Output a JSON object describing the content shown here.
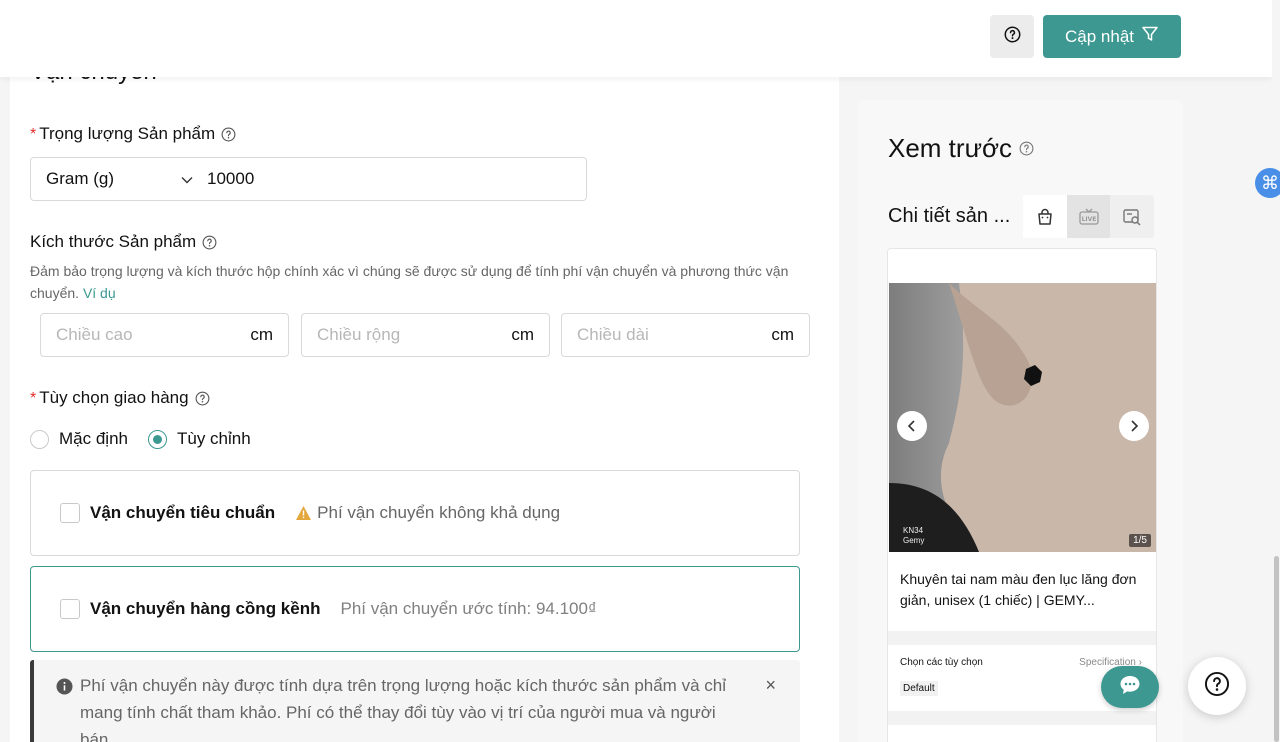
{
  "header": {
    "update_label": "Cập nhật",
    "help_icon": "question-circle-icon",
    "update_icon": "filter-funnel-icon"
  },
  "shipping": {
    "section_title": "Vận chuyển",
    "weight": {
      "label": "Trọng lượng Sản phẩm",
      "unit_selected": "Gram (g)",
      "value": "10000"
    },
    "dimensions": {
      "label": "Kích thước Sản phẩm",
      "hint": "Đảm bảo trọng lượng và kích thước hộp chính xác vì chúng sẽ được sử dụng để tính phí vận chuyển và phương thức vận chuyển.",
      "example_link": "Ví dụ",
      "fields": [
        {
          "placeholder": "Chiều cao",
          "unit": "cm"
        },
        {
          "placeholder": "Chiều rộng",
          "unit": "cm"
        },
        {
          "placeholder": "Chiều dài",
          "unit": "cm"
        }
      ]
    },
    "delivery": {
      "label": "Tùy chọn giao hàng",
      "options": [
        {
          "label": "Mặc định",
          "checked": false
        },
        {
          "label": "Tùy chỉnh",
          "checked": true
        }
      ],
      "methods": [
        {
          "name": "Vận chuyển tiêu chuẩn",
          "note": "Phí vận chuyển không khả dụng",
          "checked": false
        },
        {
          "name": "Vận chuyển hàng cồng kềnh",
          "note": "Phí vận chuyển ước tính: 94.100₫",
          "checked": false
        }
      ],
      "info": "Phí vận chuyển này được tính dựa trên trọng lượng hoặc kích thước sản phẩm và chỉ mang tính chất tham khảo. Phí có thể thay đổi tùy vào vị trí của người mua và người bán.",
      "info_close": "×"
    }
  },
  "preview": {
    "title": "Xem trước",
    "tab_label": "Chi tiết sản ...",
    "tabs": [
      "shopping-bag-icon",
      "live-icon",
      "search-preview-icon"
    ],
    "product": {
      "counter": "1/5",
      "brand_line1": "KN34",
      "brand_line2": "Gemy",
      "name": "Khuyên tai nam màu đen lục lăng đơn giản, unisex (1 chiếc) | GEMY...",
      "options_label": "Chọn các tùy chọn",
      "spec_label": "Specification",
      "default_option": "Default"
    }
  },
  "colors": {
    "accent": "#3c9890",
    "required": "#e2312f",
    "warning": "#e4a73c"
  }
}
